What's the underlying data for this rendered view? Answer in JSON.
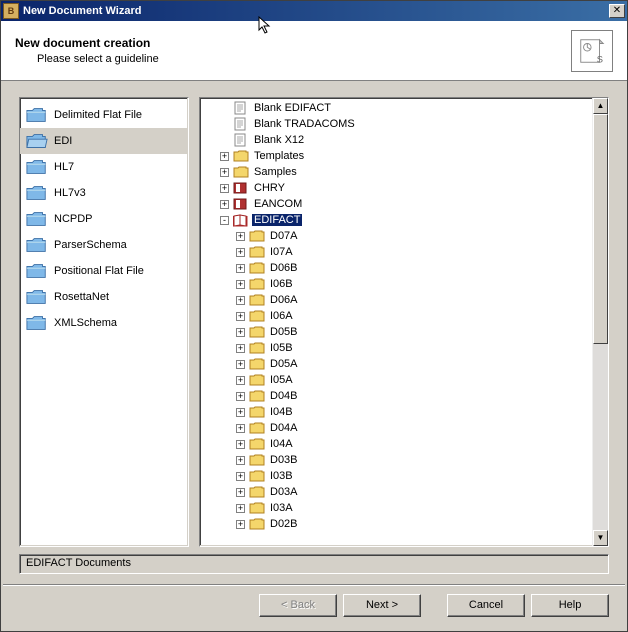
{
  "window": {
    "title": "New Document Wizard"
  },
  "header": {
    "title": "New document creation",
    "subtitle": "Please select a guideline"
  },
  "categories": [
    {
      "label": "Delimited Flat File",
      "selected": false
    },
    {
      "label": "EDI",
      "selected": true
    },
    {
      "label": "HL7",
      "selected": false
    },
    {
      "label": "HL7v3",
      "selected": false
    },
    {
      "label": "NCPDP",
      "selected": false
    },
    {
      "label": "ParserSchema",
      "selected": false
    },
    {
      "label": "Positional Flat File",
      "selected": false
    },
    {
      "label": "RosettaNet",
      "selected": false
    },
    {
      "label": "XMLSchema",
      "selected": false
    }
  ],
  "tree": [
    {
      "level": 1,
      "expand": "",
      "icon": "doc",
      "label": "Blank EDIFACT"
    },
    {
      "level": 1,
      "expand": "",
      "icon": "doc",
      "label": "Blank TRADACOMS"
    },
    {
      "level": 1,
      "expand": "",
      "icon": "doc",
      "label": "Blank X12"
    },
    {
      "level": 1,
      "expand": "+",
      "icon": "folder",
      "label": "Templates"
    },
    {
      "level": 1,
      "expand": "+",
      "icon": "folder",
      "label": "Samples"
    },
    {
      "level": 1,
      "expand": "+",
      "icon": "book",
      "label": "CHRY"
    },
    {
      "level": 1,
      "expand": "+",
      "icon": "book",
      "label": "EANCOM"
    },
    {
      "level": 1,
      "expand": "-",
      "icon": "book-open",
      "label": "EDIFACT",
      "selected": true
    },
    {
      "level": 2,
      "expand": "+",
      "icon": "folder",
      "label": "D07A"
    },
    {
      "level": 2,
      "expand": "+",
      "icon": "folder",
      "label": "I07A"
    },
    {
      "level": 2,
      "expand": "+",
      "icon": "folder",
      "label": "D06B"
    },
    {
      "level": 2,
      "expand": "+",
      "icon": "folder",
      "label": "I06B"
    },
    {
      "level": 2,
      "expand": "+",
      "icon": "folder",
      "label": "D06A"
    },
    {
      "level": 2,
      "expand": "+",
      "icon": "folder",
      "label": "I06A"
    },
    {
      "level": 2,
      "expand": "+",
      "icon": "folder",
      "label": "D05B"
    },
    {
      "level": 2,
      "expand": "+",
      "icon": "folder",
      "label": "I05B"
    },
    {
      "level": 2,
      "expand": "+",
      "icon": "folder",
      "label": "D05A"
    },
    {
      "level": 2,
      "expand": "+",
      "icon": "folder",
      "label": "I05A"
    },
    {
      "level": 2,
      "expand": "+",
      "icon": "folder",
      "label": "D04B"
    },
    {
      "level": 2,
      "expand": "+",
      "icon": "folder",
      "label": "I04B"
    },
    {
      "level": 2,
      "expand": "+",
      "icon": "folder",
      "label": "D04A"
    },
    {
      "level": 2,
      "expand": "+",
      "icon": "folder",
      "label": "I04A"
    },
    {
      "level": 2,
      "expand": "+",
      "icon": "folder",
      "label": "D03B"
    },
    {
      "level": 2,
      "expand": "+",
      "icon": "folder",
      "label": "I03B"
    },
    {
      "level": 2,
      "expand": "+",
      "icon": "folder",
      "label": "D03A"
    },
    {
      "level": 2,
      "expand": "+",
      "icon": "folder",
      "label": "I03A"
    },
    {
      "level": 2,
      "expand": "+",
      "icon": "folder",
      "label": "D02B"
    }
  ],
  "status": "EDIFACT Documents",
  "buttons": {
    "back": "< Back",
    "next": "Next >",
    "cancel": "Cancel",
    "help": "Help"
  }
}
